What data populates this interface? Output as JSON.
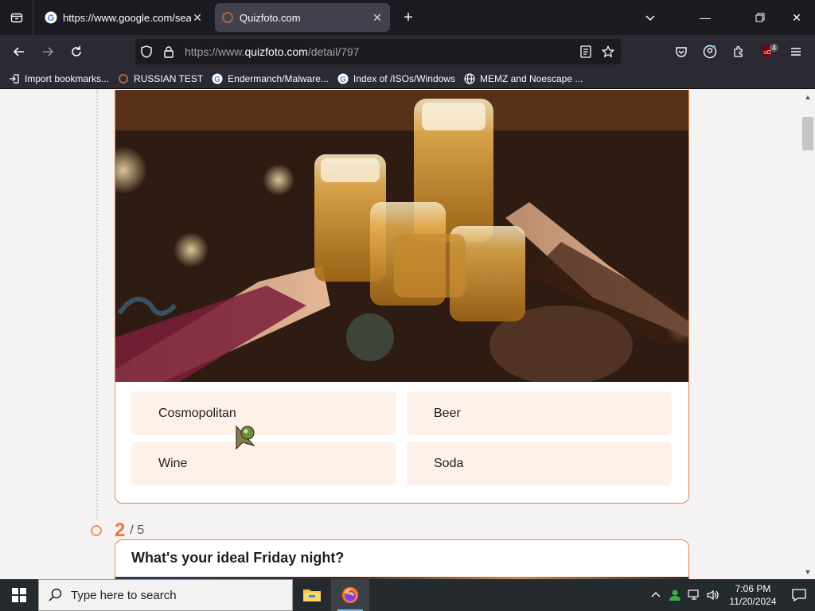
{
  "browser": {
    "tabs": [
      {
        "title": "https://www.google.com/searc",
        "favicon": "google-icon",
        "active": false
      },
      {
        "title": "Quizfoto.com",
        "favicon": "quizfoto-icon",
        "active": true
      }
    ],
    "url_prefix": "https://www.",
    "url_host": "quizfoto.com",
    "url_path": "/detail/797",
    "extension_badge": "4",
    "bookmarks": [
      {
        "label": "Import bookmarks...",
        "icon": "import-icon"
      },
      {
        "label": "RUSSIAN TEST",
        "icon": "site-icon"
      },
      {
        "label": "Endermanch/Malware...",
        "icon": "google-icon"
      },
      {
        "label": "Index of /ISOs/Windows",
        "icon": "google-icon"
      },
      {
        "label": "MEMZ and Noescape ...",
        "icon": "globe-icon"
      }
    ]
  },
  "quiz": {
    "question1": {
      "image": "friends-clinking-beer-mugs-photo",
      "answers": [
        "Cosmopolitan",
        "Beer",
        "Wine",
        "Soda"
      ]
    },
    "step": {
      "current": "2",
      "total": "/ 5"
    },
    "question2": {
      "text": "What's your ideal Friday night?"
    }
  },
  "taskbar": {
    "search_placeholder": "Type here to search",
    "time": "7:06 PM",
    "date": "11/20/2024"
  },
  "colors": {
    "accent": "#e6783b",
    "answer_bg": "#fdf1ea",
    "chrome_dark": "#1c1b22"
  }
}
